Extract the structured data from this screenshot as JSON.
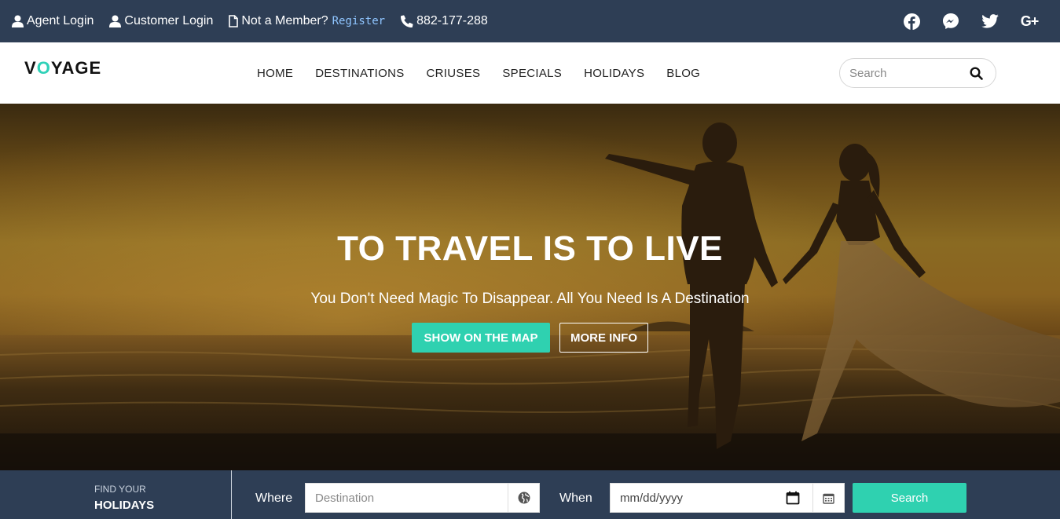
{
  "topbar": {
    "agent_login": "Agent Login",
    "customer_login": "Customer Login",
    "member_text": "Not a Member?",
    "register": "Register",
    "phone": "882-177-288",
    "social": [
      "facebook-icon",
      "messenger-icon",
      "twitter-icon",
      "google-plus-icon"
    ],
    "google_plus_label": "G+"
  },
  "nav": {
    "logo_v": "V",
    "logo_o": "O",
    "logo_rest": "YAGE",
    "items": [
      "HOME",
      "DESTINATIONS",
      "CRIUSES",
      "SPECIALS",
      "HOLIDAYS",
      "BLOG"
    ],
    "search_placeholder": "Search"
  },
  "hero": {
    "title": "TO TRAVEL IS TO LIVE",
    "subtitle": "You Don't Need Magic To Disappear. All You Need Is A Destination",
    "primary_button": "SHOW ON THE MAP",
    "secondary_button": "MORE INFO"
  },
  "booking": {
    "find_small": "FIND YOUR",
    "find_big": "HOLIDAYS",
    "where_label": "Where",
    "destination_placeholder": "Destination",
    "when_label": "When",
    "date_placeholder": "mm/dd/yyyy",
    "search_button": "Search"
  },
  "colors": {
    "topbar_bg": "#2e3e55",
    "accent": "#2fd1b0",
    "register_link": "#8fc5ff"
  }
}
